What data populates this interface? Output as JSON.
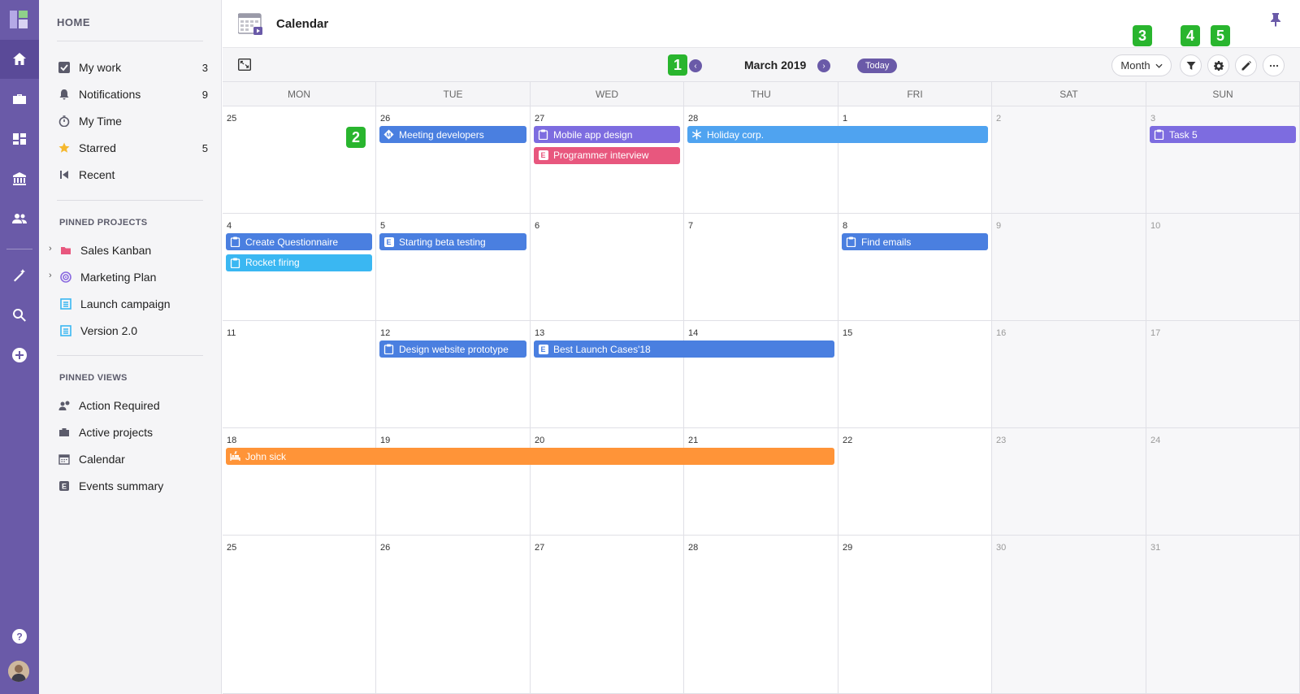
{
  "sidebar": {
    "home_label": "HOME",
    "items": [
      {
        "label": "My work",
        "count": "3"
      },
      {
        "label": "Notifications",
        "count": "9"
      },
      {
        "label": "My Time",
        "count": ""
      },
      {
        "label": "Starred",
        "count": "5"
      },
      {
        "label": "Recent",
        "count": ""
      }
    ],
    "pinned_projects_label": "PINNED PROJECTS",
    "pinned_projects": [
      {
        "label": "Sales Kanban"
      },
      {
        "label": "Marketing Plan"
      },
      {
        "label": "Launch campaign"
      },
      {
        "label": "Version 2.0"
      }
    ],
    "pinned_views_label": "PINNED VIEWS",
    "pinned_views": [
      {
        "label": "Action Required"
      },
      {
        "label": "Active projects"
      },
      {
        "label": "Calendar"
      },
      {
        "label": "Events summary"
      }
    ]
  },
  "header": {
    "title": "Calendar"
  },
  "toolbar": {
    "month_label": "March 2019",
    "today_label": "Today",
    "view_select": "Month"
  },
  "badges": [
    "1",
    "2",
    "3",
    "4",
    "5"
  ],
  "calendar": {
    "weekdays": [
      "MON",
      "TUE",
      "WED",
      "THU",
      "FRI",
      "SAT",
      "SUN"
    ],
    "weeks": [
      [
        "25",
        "26",
        "27",
        "28",
        "1",
        "2",
        "3"
      ],
      [
        "4",
        "5",
        "6",
        "7",
        "8",
        "9",
        "10"
      ],
      [
        "11",
        "12",
        "13",
        "14",
        "15",
        "16",
        "17"
      ],
      [
        "18",
        "19",
        "20",
        "21",
        "22",
        "23",
        "24"
      ],
      [
        "25",
        "26",
        "27",
        "28",
        "29",
        "30",
        "31"
      ]
    ],
    "events": [
      {
        "title": "Meeting developers",
        "color": "#4a7fe0"
      },
      {
        "title": "Mobile app design",
        "color": "#7d6ce0"
      },
      {
        "title": "Programmer interview",
        "color": "#e8577e"
      },
      {
        "title": "Holiday corp.",
        "color": "#4fa3f0"
      },
      {
        "title": "Task 5",
        "color": "#7d6ce0"
      },
      {
        "title": "Create Questionnaire",
        "color": "#4a7fe0"
      },
      {
        "title": "Rocket firing",
        "color": "#3ab7f2"
      },
      {
        "title": "Starting beta testing",
        "color": "#4a7fe0"
      },
      {
        "title": "Find emails",
        "color": "#4a7fe0"
      },
      {
        "title": "Design website prototype",
        "color": "#4a7fe0"
      },
      {
        "title": "Best Launch Cases'18",
        "color": "#4a7fe0"
      },
      {
        "title": "John sick",
        "color": "#ff9438"
      }
    ]
  },
  "colors": {
    "rail": "#6a5aa8",
    "accent": "#6a5aa8",
    "badge": "#29b52e"
  }
}
